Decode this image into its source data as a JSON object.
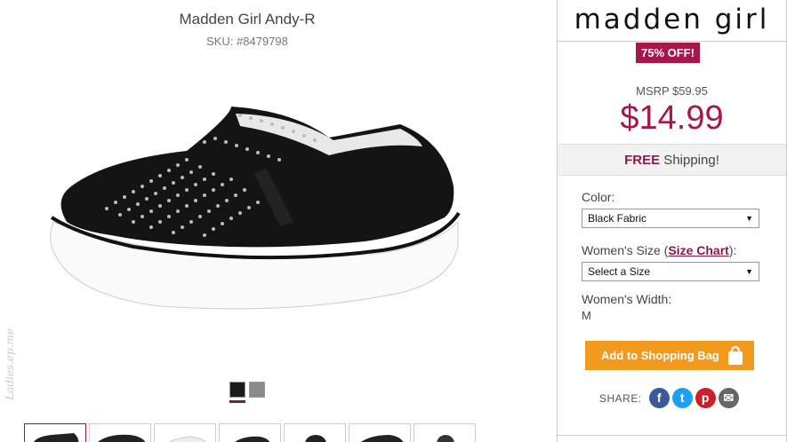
{
  "product": {
    "title": "Madden Girl Andy-R",
    "sku": "SKU: #8479798"
  },
  "swatches": [
    {
      "name": "Black Fabric",
      "color": "#1a1a1a"
    },
    {
      "name": "Gray",
      "color": "#8a8a8a"
    }
  ],
  "watermark": "Ladies.ep.me",
  "panel": {
    "brand": "madden girl",
    "discount_badge": "75% OFF!",
    "msrp": "MSRP $59.95",
    "price": "$14.99",
    "shipping_bold": "FREE",
    "shipping_rest": " Shipping!",
    "color_label": "Color:",
    "color_value": "Black Fabric",
    "size_label_pre": "Women's Size (",
    "size_chart_link": "Size Chart",
    "size_label_post": "):",
    "size_value": "Select a Size",
    "width_label": "Women's Width:",
    "width_value": "M",
    "add_to_bag": "Add to Shopping Bag",
    "share_label": "SHARE:"
  },
  "colors": {
    "accent": "#a8174a",
    "button": "#f29a1d"
  },
  "icons": [
    "facebook-icon",
    "twitter-icon",
    "pinterest-icon",
    "email-icon",
    "shopping-bag-icon",
    "dropdown-arrow-icon"
  ]
}
